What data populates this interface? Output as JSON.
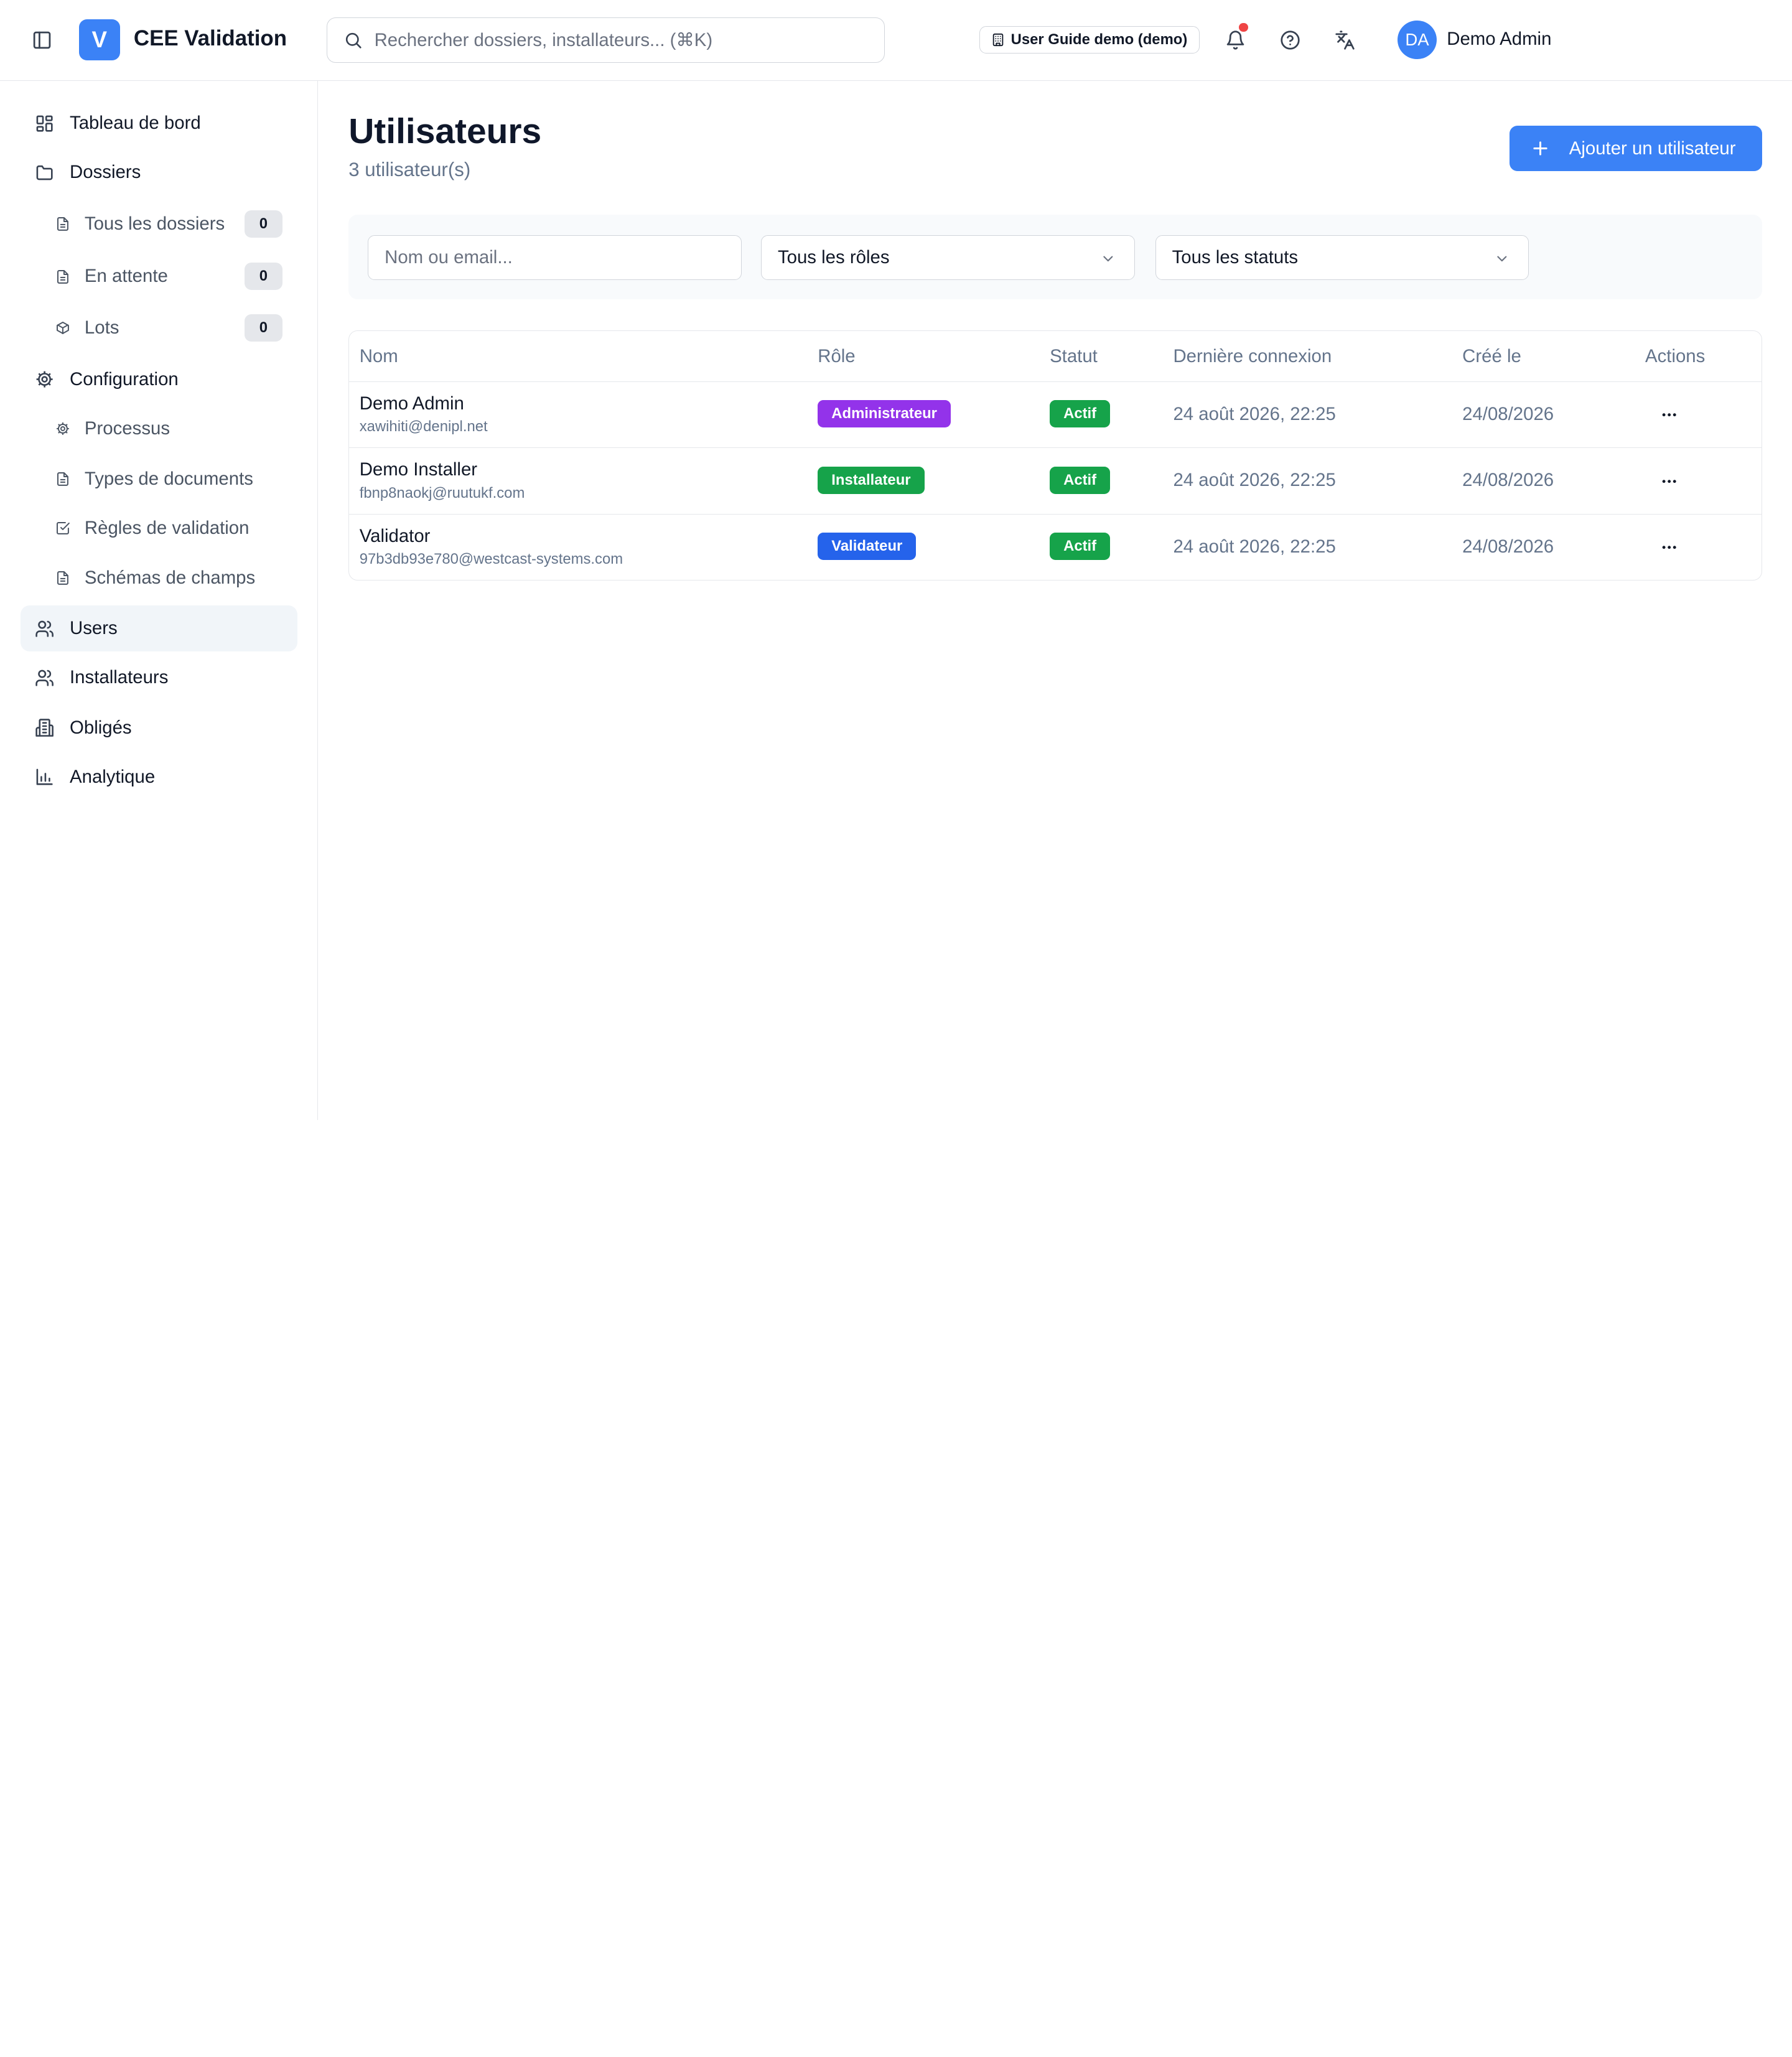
{
  "header": {
    "app_logo_letter": "V",
    "app_title": "CEE Validation",
    "search_placeholder": "Rechercher dossiers, installateurs... (⌘K)",
    "org_badge": "User Guide demo (demo)",
    "user_initials": "DA",
    "user_name": "Demo Admin"
  },
  "sidebar": {
    "tableau": "Tableau de bord",
    "dossiers": "Dossiers",
    "dossiers_sub": [
      {
        "label": "Tous les dossiers",
        "count": "0"
      },
      {
        "label": "En attente",
        "count": "0"
      },
      {
        "label": "Lots",
        "count": "0"
      }
    ],
    "configuration": "Configuration",
    "config_sub": [
      {
        "label": "Processus"
      },
      {
        "label": "Types de documents"
      },
      {
        "label": "Règles de validation"
      },
      {
        "label": "Schémas de champs"
      }
    ],
    "users": "Users",
    "installateurs": "Installateurs",
    "obliges": "Obligés",
    "analytique": "Analytique"
  },
  "main": {
    "title": "Utilisateurs",
    "subtitle": "3 utilisateur(s)",
    "add_button": "Ajouter un utilisateur",
    "filters": {
      "search_placeholder": "Nom ou email...",
      "role_value": "Tous les rôles",
      "status_value": "Tous les statuts"
    },
    "table": {
      "headers": [
        "Nom",
        "Rôle",
        "Statut",
        "Dernière connexion",
        "Créé le",
        "Actions"
      ],
      "rows": [
        {
          "name": "Demo Admin",
          "email": "xawihiti@denipl.net",
          "role": "Administrateur",
          "status": "Actif",
          "last_login": "24 août 2026, 22:25",
          "created": "24/08/2026"
        },
        {
          "name": "Demo Installer",
          "email": "fbnp8naokj@ruutukf.com",
          "role": "Installateur",
          "status": "Actif",
          "last_login": "24 août 2026, 22:25",
          "created": "24/08/2026"
        },
        {
          "name": "Validator",
          "email": "97b3db93e780@westcast-systems.com",
          "role": "Validateur",
          "status": "Actif",
          "last_login": "24 août 2026, 22:25",
          "created": "24/08/2026"
        }
      ]
    }
  },
  "colors": {
    "accent": "#3b82f6",
    "role_admin": "#9333ea",
    "role_installer": "#16a34a",
    "role_validator": "#2563eb",
    "status_active": "#16a34a",
    "notification": "#ef4444"
  },
  "icons": {
    "sidebar_toggle": "panel-left-icon",
    "search": "search-icon",
    "org": "building-icon",
    "bell": "bell-icon",
    "help": "help-circle-icon",
    "language": "translate-icon",
    "add": "plus-icon",
    "chevron": "chevron-down-icon",
    "row_actions": "more-horizontal-icon"
  }
}
